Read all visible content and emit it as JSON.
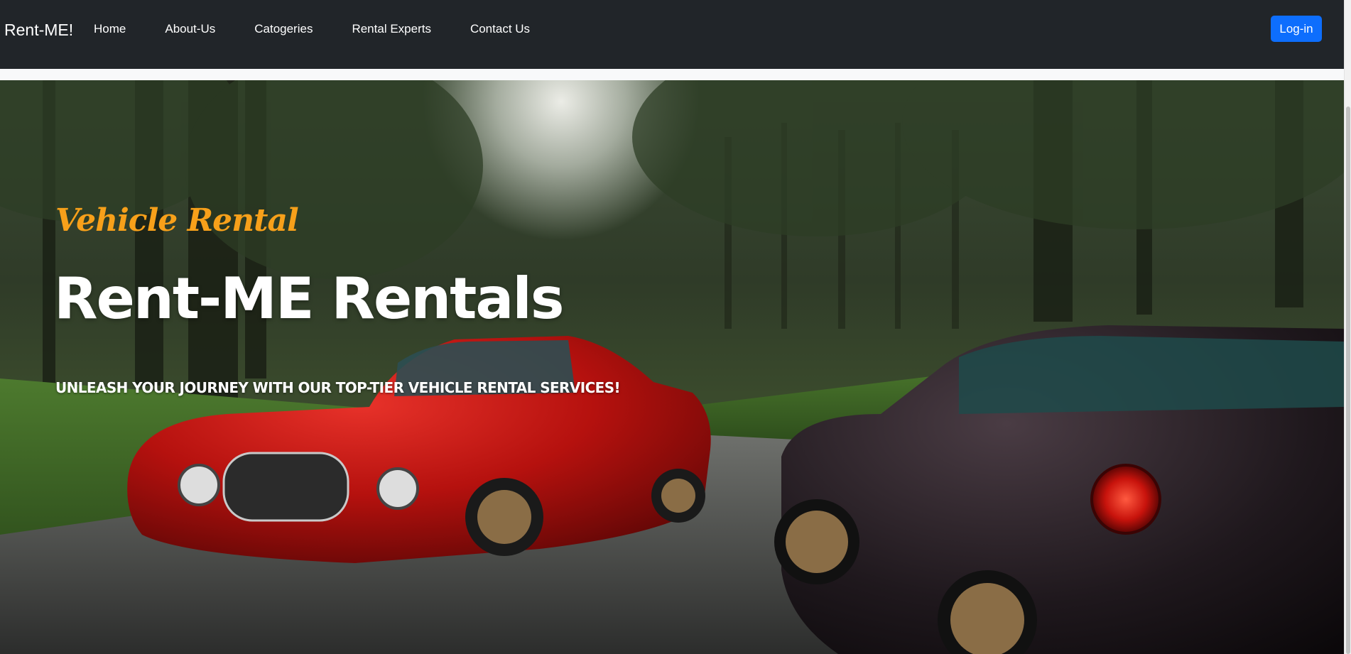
{
  "navbar": {
    "brand": "Rent-ME!",
    "links": [
      "Home",
      "About-Us",
      "Catogeries",
      "Rental Experts",
      "Contact Us"
    ],
    "login_label": "Log-in"
  },
  "hero": {
    "kicker": "Vehicle Rental",
    "headline": "Rent-ME Rentals",
    "tagline": "UNLEASH YOUR JOURNEY WITH OUR TOP-TIER VEHICLE RENTAL SERVICES!"
  },
  "colors": {
    "navbar_bg": "#212529",
    "login_button": "#0d6efd",
    "kicker": "#f7a01a",
    "headline": "#ffffff"
  }
}
